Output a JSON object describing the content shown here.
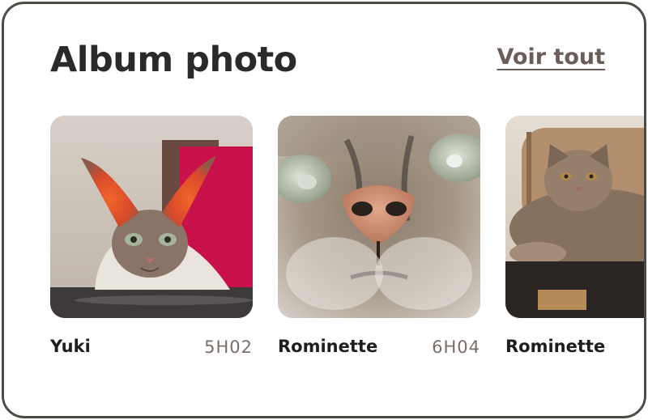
{
  "section": {
    "title": "Album photo",
    "see_all_label": "Voir tout"
  },
  "photos": [
    {
      "name": "Yuki",
      "time": "5H02",
      "subject": "sphynx-cat-photo"
    },
    {
      "name": "Rominette",
      "time": "6H04",
      "subject": "cat-nose-closeup-photo"
    },
    {
      "name": "Rominette",
      "time": "",
      "subject": "tabby-cat-on-chair-photo"
    }
  ],
  "colors": {
    "frame_border": "#4a4c43",
    "title": "#2a2a2a",
    "link": "#6b5e58",
    "time": "#7a6e68"
  }
}
